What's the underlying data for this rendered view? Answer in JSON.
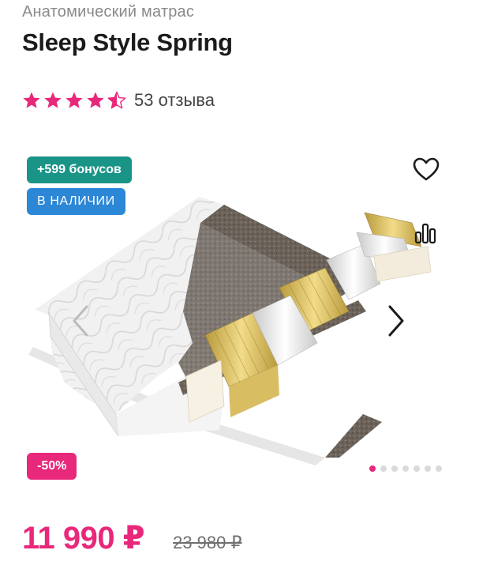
{
  "product": {
    "category": "Анатомический матрас",
    "title": "Sleep Style Spring"
  },
  "rating": {
    "value": 4.5,
    "max": 5,
    "reviews_label": "53 отзыва"
  },
  "gallery": {
    "badges": {
      "bonus": "+599 бонусов",
      "stock": "В НАЛИЧИИ",
      "discount": "-50%"
    },
    "icons": {
      "favorite": "heart-icon",
      "compare": "compare-chart-icon",
      "prev": "chevron-left-icon",
      "next": "chevron-right-icon"
    },
    "slides_total": 7,
    "active_slide": 1
  },
  "pricing": {
    "price": "11 990 ₽",
    "old_price": "23 980 ₽"
  },
  "colors": {
    "accent": "#e8287b",
    "bonus_badge": "#1b9488",
    "stock_badge": "#2c87d6"
  }
}
